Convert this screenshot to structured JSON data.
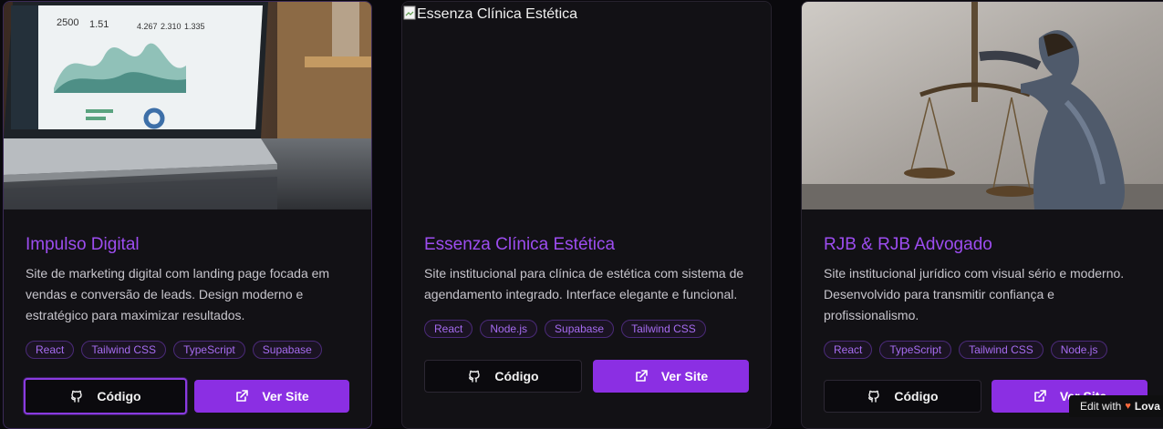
{
  "projects": [
    {
      "title": "Impulso Digital",
      "description": "Site de marketing digital com landing page focada em vendas e conversão de leads. Design moderno e estratégico para maximizar resultados.",
      "tags": [
        "React",
        "Tailwind CSS",
        "TypeScript",
        "Supabase"
      ],
      "code_label": "Código",
      "site_label": "Ver Site",
      "image_icon": "laptop-dashboard-photo",
      "screen_numbers": [
        "2500",
        "1.51",
        "4.267",
        "2.310",
        "1.335"
      ]
    },
    {
      "title": "Essenza Clínica Estética",
      "description": "Site institucional para clínica de estética com sistema de agendamento integrado. Interface elegante e funcional.",
      "tags": [
        "React",
        "Node.js",
        "Supabase",
        "Tailwind CSS"
      ],
      "code_label": "Código",
      "site_label": "Ver Site",
      "image_alt": "Essenza Clínica Estética"
    },
    {
      "title": "RJB & RJB Advogado",
      "description": "Site institucional jurídico com visual sério e moderno. Desenvolvido para transmitir confiança e profissionalismo.",
      "tags": [
        "React",
        "TypeScript",
        "Tailwind CSS",
        "Node.js"
      ],
      "code_label": "Código",
      "site_label": "Ver Site",
      "image_icon": "justice-statue-photo"
    }
  ],
  "edit_badge": {
    "prefix": "Edit with",
    "brand": "Lova"
  },
  "colors": {
    "accent": "#8b2fe3",
    "title": "#9d4df0",
    "background": "#0a090d",
    "card": "#121115"
  }
}
